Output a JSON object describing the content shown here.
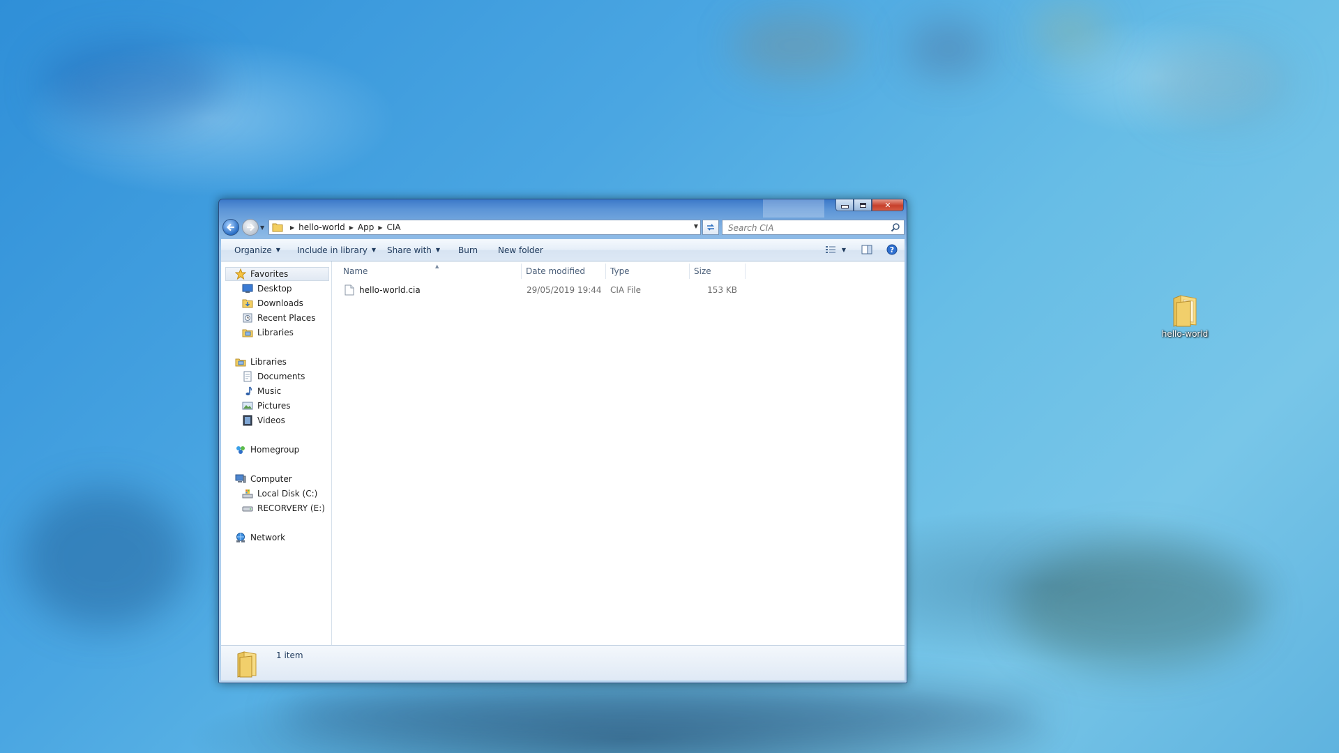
{
  "address": {
    "crumbs": [
      "hello-world",
      "App",
      "CIA"
    ],
    "search_placeholder": "Search CIA"
  },
  "toolbar": {
    "organize": "Organize",
    "include_in_library": "Include in library",
    "share_with": "Share with",
    "burn": "Burn",
    "new_folder": "New folder"
  },
  "nav": {
    "favorites": {
      "label": "Favorites",
      "items": [
        "Desktop",
        "Downloads",
        "Recent Places",
        "Libraries"
      ]
    },
    "libraries": {
      "label": "Libraries",
      "items": [
        "Documents",
        "Music",
        "Pictures",
        "Videos"
      ]
    },
    "homegroup": "Homegroup",
    "computer": {
      "label": "Computer",
      "items": [
        "Local Disk (C:)",
        "RECORVERY (E:)"
      ]
    },
    "network": "Network"
  },
  "columns": {
    "name": "Name",
    "date": "Date modified",
    "type": "Type",
    "size": "Size"
  },
  "files": [
    {
      "name": "hello-world.cia",
      "date": "29/05/2019 19:44",
      "type": "CIA File",
      "size": "153 KB"
    }
  ],
  "status": {
    "count": "1 item"
  },
  "desktop": {
    "icon_label": "hello-world"
  },
  "colors": {
    "accent": "#3b78c9",
    "toolbar_text": "#1e395b"
  }
}
